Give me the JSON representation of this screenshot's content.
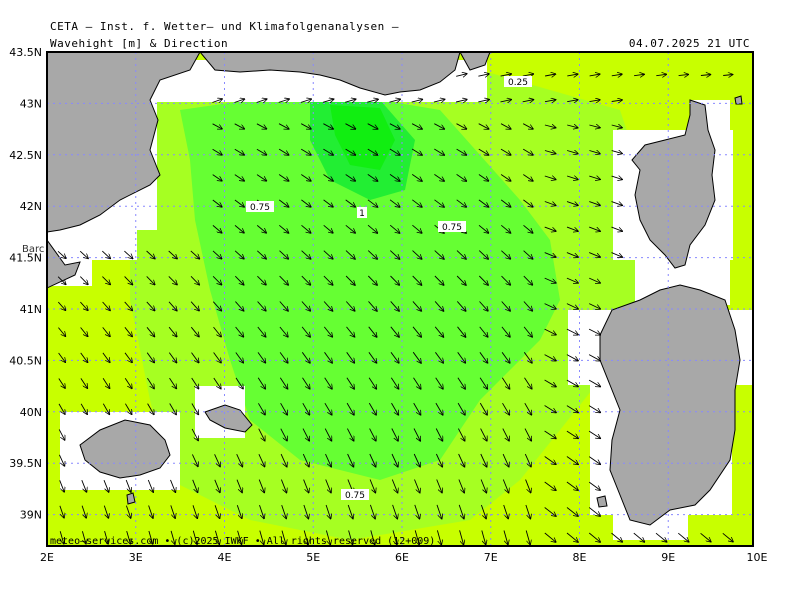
{
  "header": {
    "source": "CETA – Inst. f. Wetter– und Klimafolgenanalysen –",
    "field": "Wavehight [m] & Direction",
    "valid_time": "04.07.2025 21 UTC"
  },
  "footer": "meteo–services.com • (c)2025 IWKF • All rights reserved (12+009)",
  "axes": {
    "lon_labels": [
      "2E",
      "3E",
      "4E",
      "5E",
      "6E",
      "7E",
      "8E",
      "9E",
      "10E"
    ],
    "lat_labels": [
      "43.5N",
      "43N",
      "42.5N",
      "42N",
      "41.5N",
      "41N",
      "40.5N",
      "40N",
      "39.5N",
      "39N"
    ]
  },
  "city_label": "Barc",
  "contour_labels": [
    "0.25",
    "0.75",
    "1",
    "0.75",
    "0.75"
  ],
  "colors": {
    "land": "#a8a8a8",
    "sea_low": "#c8ff00",
    "sea_mid": "#66ff33",
    "sea_high": "#22ee33",
    "grid": "#8888ff"
  }
}
